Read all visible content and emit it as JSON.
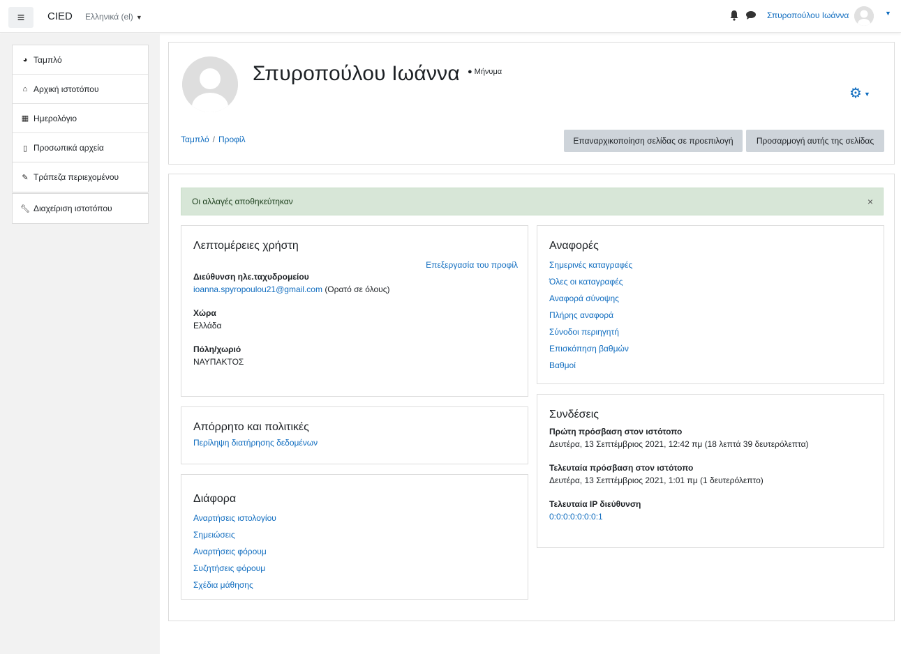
{
  "navbar": {
    "brand": "CIED",
    "language": "Ελληνικά (el)",
    "user_name": "Σπυροπούλου Ιωάννα"
  },
  "sidebar": {
    "group1": [
      {
        "icon": "dashboard-icon",
        "label": "Ταμπλό"
      },
      {
        "icon": "home-icon",
        "label": "Αρχική ιστοτόπου"
      },
      {
        "icon": "calendar-icon",
        "label": "Ημερολόγιο"
      },
      {
        "icon": "file-icon",
        "label": "Προσωπικά αρχεία"
      }
    ],
    "group2": [
      {
        "icon": "paintbrush-icon",
        "label": "Τράπεζα περιεχομένου"
      }
    ],
    "group3": [
      {
        "icon": "wrench-icon",
        "label": "Διαχείριση ιστοτόπου"
      }
    ]
  },
  "header": {
    "title": "Σπυροπούλου Ιωάννα",
    "message_link": "Μήνυμα",
    "breadcrumb": [
      "Ταμπλό",
      "Προφίλ"
    ],
    "reset_button": "Επαναρχικοποίηση σελίδας σε προεπιλογή",
    "customize_button": "Προσαρμογή αυτής της σελίδας"
  },
  "alert": {
    "text": "Οι αλλαγές αποθηκεύτηκαν",
    "close": "×"
  },
  "user_details": {
    "title": "Λεπτομέρειες χρήστη",
    "edit_link": "Επεξεργασία του προφίλ",
    "email_label": "Διεύθυνση ηλε.ταχυδρομείου",
    "email_value": "ioanna.spyropoulou21@gmail.com",
    "email_visibility": "(Ορατό σε όλους)",
    "country_label": "Χώρα",
    "country_value": "Ελλάδα",
    "city_label": "Πόλη/χωριό",
    "city_value": "ΝΑΥΠΑΚΤΟΣ"
  },
  "privacy": {
    "title": "Απόρρητο και πολιτικές",
    "link": "Περίληψη διατήρησης δεδομένων"
  },
  "misc": {
    "title": "Διάφορα",
    "links": [
      "Αναρτήσεις ιστολογίου",
      "Σημειώσεις",
      "Αναρτήσεις φόρουμ",
      "Συζητήσεις φόρουμ",
      "Σχέδια μάθησης"
    ]
  },
  "reports": {
    "title": "Αναφορές",
    "links": [
      "Σημερινές καταγραφές",
      "Όλες οι καταγραφές",
      "Αναφορά σύνοψης",
      "Πλήρης αναφορά",
      "Σύνοδοι περιηγητή",
      "Επισκόπηση βαθμών",
      "Βαθμοί"
    ]
  },
  "logins": {
    "title": "Συνδέσεις",
    "first_access_label": "Πρώτη πρόσβαση στον ιστότοπο",
    "first_access_value": "Δευτέρα, 13 Σεπτέμβριος 2021, 12:42 πμ  (18 λεπτά 39 δευτερόλεπτα)",
    "last_access_label": "Τελευταία πρόσβαση στον ιστότοπο",
    "last_access_value": "Δευτέρα, 13 Σεπτέμβριος 2021, 1:01 πμ  (1 δευτερόλεπτο)",
    "last_ip_label": "Τελευταία IP διεύθυνση",
    "last_ip_value": "0:0:0:0:0:0:0:1"
  },
  "colors": {
    "link": "#0f6cbf",
    "alert_bg": "#d7e6d7",
    "button_bg": "#ced4da",
    "drawer_bg": "#f2f2f2"
  }
}
